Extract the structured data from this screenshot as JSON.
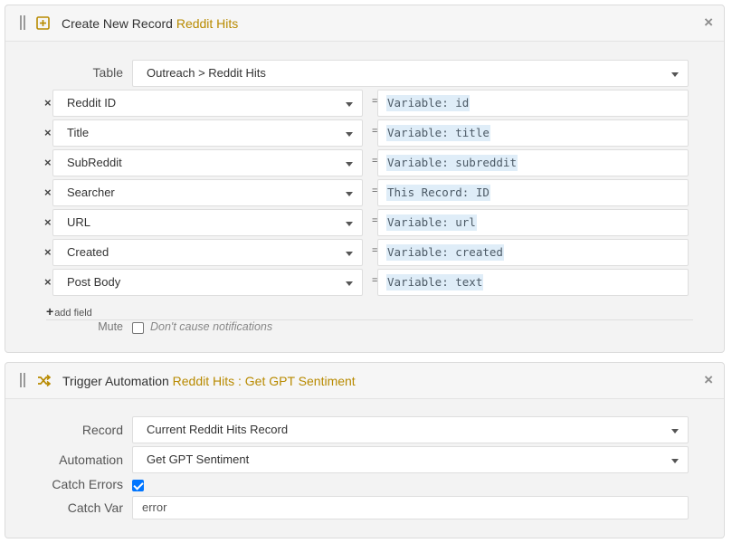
{
  "create_card": {
    "title_prefix": "Create New Record",
    "title_accent": "Reddit Hits",
    "close": "×",
    "table_label": "Table",
    "table_value": "Outreach > Reddit Hits",
    "fields": [
      {
        "name": "Reddit ID",
        "value": "Variable: id"
      },
      {
        "name": "Title",
        "value": "Variable: title"
      },
      {
        "name": "SubReddit",
        "value": "Variable: subreddit"
      },
      {
        "name": "Searcher",
        "value": "This Record: ID"
      },
      {
        "name": "URL",
        "value": "Variable: url"
      },
      {
        "name": "Created",
        "value": "Variable: created"
      },
      {
        "name": "Post Body",
        "value": "Variable: text"
      }
    ],
    "remove_symbol": "×",
    "equals": "=",
    "add_field_plus": "+",
    "add_field_label": "add field",
    "mute_label": "Mute",
    "mute_hint": "Don't cause notifications",
    "mute_checked": false
  },
  "trigger_card": {
    "title_prefix": "Trigger Automation",
    "title_accent": "Reddit Hits : Get GPT Sentiment",
    "close": "×",
    "record_label": "Record",
    "record_value": "Current Reddit Hits Record",
    "automation_label": "Automation",
    "automation_value": "Get GPT Sentiment",
    "catch_errors_label": "Catch Errors",
    "catch_errors_checked": true,
    "catch_var_label": "Catch Var",
    "catch_var_value": "error"
  },
  "colors": {
    "accent": "#b88a00",
    "token_bg": "#dfedf8",
    "checkbox_checked": "#0075ff"
  },
  "icons": {
    "create_icon": "plus-square-icon",
    "trigger_icon": "shuffle-icon"
  }
}
